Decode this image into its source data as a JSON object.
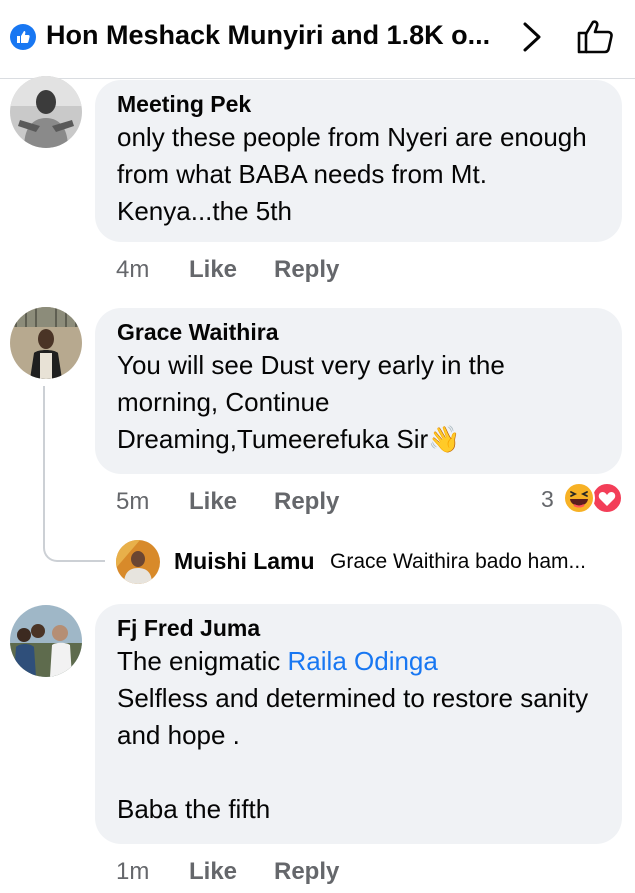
{
  "header": {
    "title": "Hon Meshack Munyiri and 1.8K o..."
  },
  "comments": [
    {
      "author": "Meeting Pek",
      "text": "only these people from Nyeri are enough from what BABA needs from Mt. Kenya...the 5th",
      "time": "4m",
      "like_label": "Like",
      "reply_label": "Reply"
    },
    {
      "author": "Grace Waithira",
      "text": "You will see Dust very early in the morning, Continue Dreaming,Tumeerefuka  Sir👋",
      "time": "5m",
      "like_label": "Like",
      "reply_label": "Reply",
      "reaction_count": "3",
      "reactions": [
        "laughing-emoji",
        "love-heart"
      ],
      "reply_preview": {
        "author": "Muishi Lamu",
        "text": "Grace Waithira bado ham..."
      }
    },
    {
      "author": "Fj Fred Juma",
      "text_prefix": "The enigmatic ",
      "mention": "Raila Odinga",
      "text_line2": "Selfless and determined to restore sanity and hope .",
      "text_line3": "Baba the fifth",
      "time": "1m",
      "like_label": "Like",
      "reply_label": "Reply"
    }
  ],
  "colors": {
    "accent": "#1877f2",
    "bubble": "#f0f2f5",
    "meta_text": "#65676b"
  }
}
